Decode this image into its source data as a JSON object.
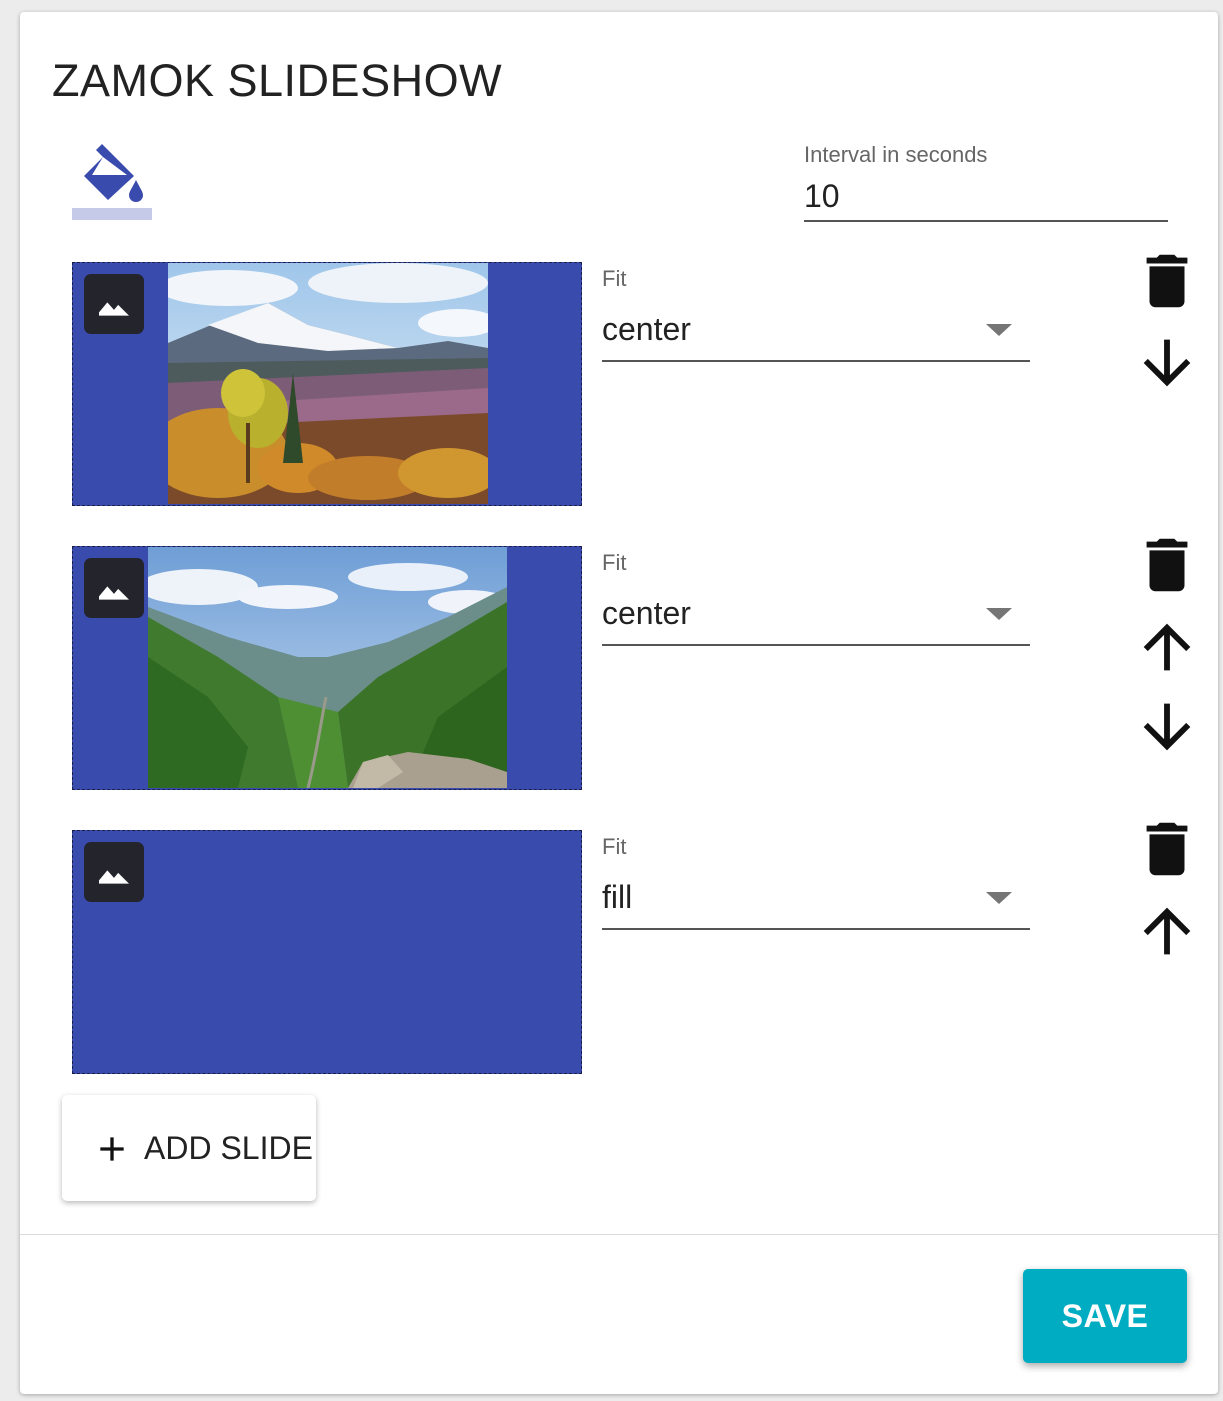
{
  "title": "ZAMOK SLIDESHOW",
  "colors": {
    "accent": "#3a4bae",
    "save_button": "#00acc1",
    "paint_underline": "#c5cae9",
    "icon_dark": "#23242c"
  },
  "icons": {
    "paint": "format-color-fill-icon",
    "image": "image-icon",
    "delete": "trash-icon",
    "move_up": "arrow-up-icon",
    "move_down": "arrow-down-icon",
    "add": "plus-icon"
  },
  "interval": {
    "label": "Interval in seconds",
    "value": "10"
  },
  "slides": [
    {
      "fit_label": "Fit",
      "fit_value": "center",
      "image": "snowy mountain with autumn forest",
      "actions": [
        "delete",
        "move_down"
      ]
    },
    {
      "fit_label": "Fit",
      "fit_value": "center",
      "image": "green valley with winding road",
      "actions": [
        "delete",
        "move_up",
        "move_down"
      ]
    },
    {
      "fit_label": "Fit",
      "fit_value": "fill",
      "image": "",
      "actions": [
        "delete",
        "move_up"
      ]
    }
  ],
  "add_slide_label": "ADD SLIDE",
  "save_label": "SAVE"
}
